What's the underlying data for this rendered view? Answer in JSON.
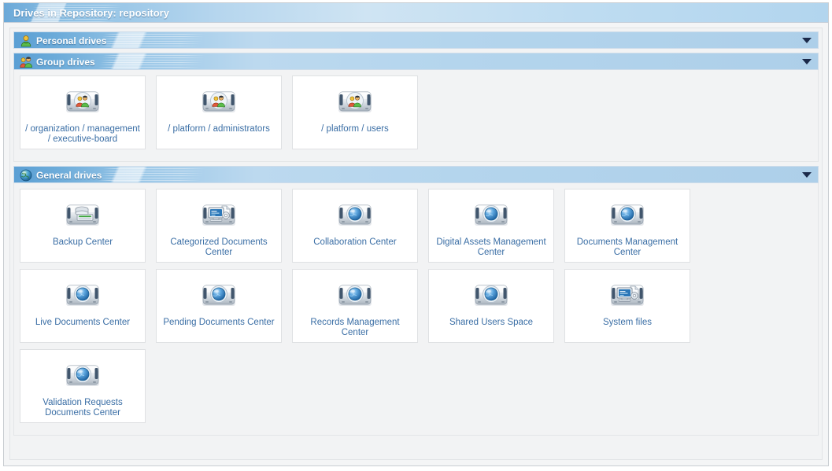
{
  "window": {
    "title": "Drives in Repository: repository"
  },
  "colors": {
    "title_bar_blue": "#b6d6ee",
    "section_header_blue": "#9cc8e8",
    "link_blue": "#3a6ea5",
    "toggle_arrow": "#1b2a4a",
    "tile_background": "#ffffff",
    "panel_background": "#f2f3f4"
  },
  "sections": [
    {
      "id": "personal-drives",
      "label": "Personal drives",
      "icon": "single-user-icon",
      "toggle": "chevron-down-icon",
      "expanded": false,
      "tiles": []
    },
    {
      "id": "group-drives",
      "label": "Group drives",
      "icon": "group-users-icon",
      "toggle": "chevron-down-icon",
      "expanded": true,
      "tiles": [
        {
          "label": "/ organization / management / executive-board",
          "icon": "group-drive-icon"
        },
        {
          "label": "/ platform / administrators",
          "icon": "group-drive-icon"
        },
        {
          "label": "/ platform / users",
          "icon": "group-drive-icon"
        }
      ]
    },
    {
      "id": "general-drives",
      "label": "General drives",
      "icon": "globe-icon",
      "toggle": "chevron-down-icon",
      "expanded": true,
      "tiles": [
        {
          "label": "Backup Center",
          "icon": "backup-drive-icon"
        },
        {
          "label": "Categorized Documents Center",
          "icon": "system-monitor-drive-icon"
        },
        {
          "label": "Collaboration Center",
          "icon": "globe-drive-icon"
        },
        {
          "label": "Digital Assets Management Center",
          "icon": "globe-drive-icon"
        },
        {
          "label": "Documents Management Center",
          "icon": "globe-drive-icon"
        },
        {
          "label": "Live Documents Center",
          "icon": "globe-drive-icon"
        },
        {
          "label": "Pending Documents Center",
          "icon": "globe-drive-icon"
        },
        {
          "label": "Records Management Center",
          "icon": "globe-drive-icon"
        },
        {
          "label": "Shared Users Space",
          "icon": "globe-drive-icon"
        },
        {
          "label": "System files",
          "icon": "system-monitor-drive-icon"
        },
        {
          "label": "Validation Requests Documents Center",
          "icon": "globe-drive-icon"
        }
      ]
    }
  ]
}
